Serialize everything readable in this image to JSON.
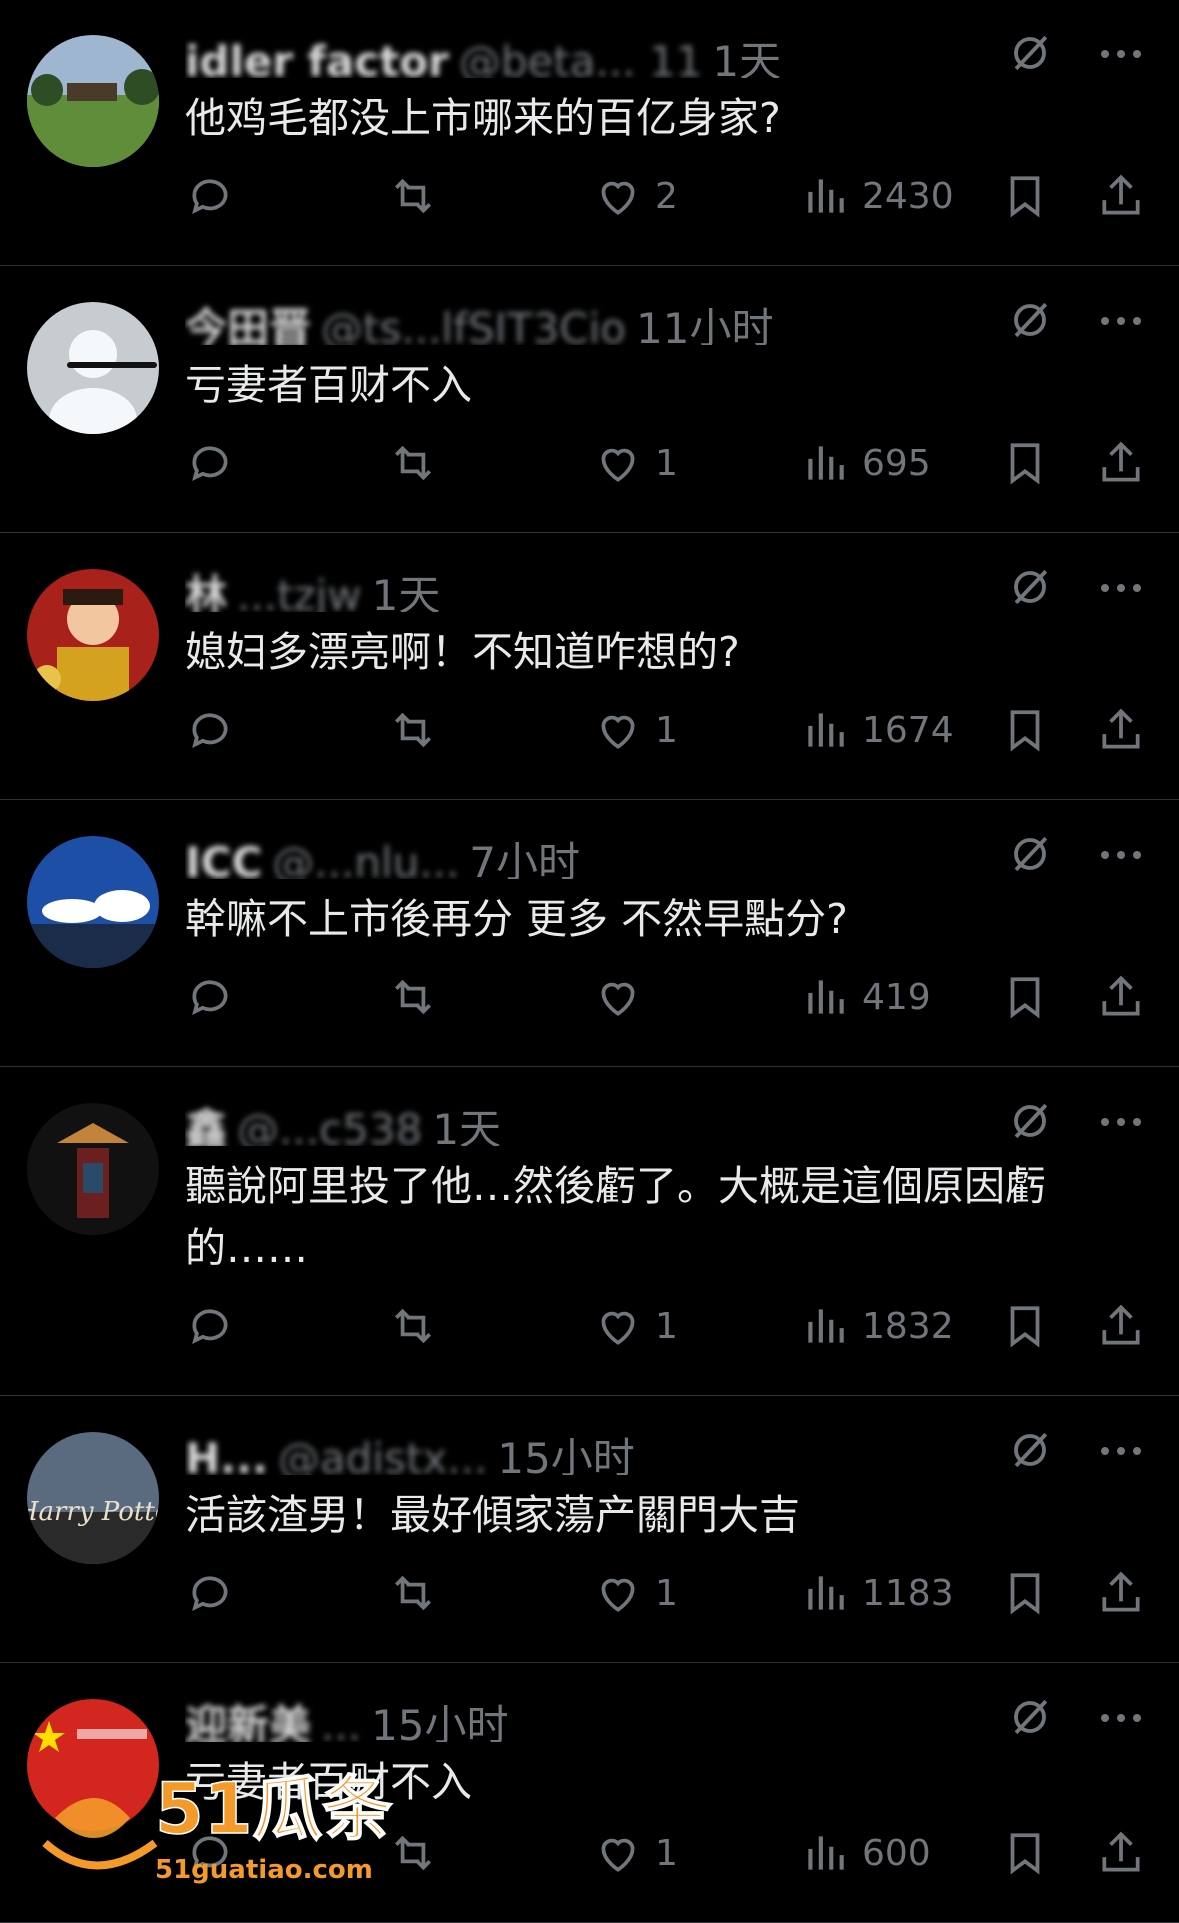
{
  "replies": [
    {
      "name": "idler factor",
      "handle": "@beta... 11",
      "time": "1天",
      "text": "他鸡毛都没上市哪来的百亿身家?",
      "likes": "2",
      "views": "2430",
      "avatar": "golf-course-avatar"
    },
    {
      "name": "今田晋",
      "handle": "@ts...lfSIT3Cio",
      "time": "11小时",
      "text": "亏妻者百财不入",
      "likes": "1",
      "views": "695",
      "avatar": "default-profile-avatar"
    },
    {
      "name": "林",
      "handle": "...tzjw",
      "time": "1天",
      "text": "媳妇多漂亮啊！不知道咋想的?",
      "likes": "1",
      "views": "1674",
      "avatar": "god-of-wealth-avatar"
    },
    {
      "name": "ICC",
      "handle": "@...nlu...",
      "time": "7小时",
      "text": "幹嘛不上市後再分 更多 不然早點分?",
      "likes": "",
      "views": "419",
      "avatar": "sky-clouds-avatar"
    },
    {
      "name": "鑫",
      "handle": "@...c538",
      "time": "1天",
      "text": "聽說阿里投了他…然後虧了。大概是這個原因虧的……",
      "likes": "1",
      "views": "1832",
      "avatar": "dark-figure-avatar"
    },
    {
      "name": "H...",
      "handle": "@adistx...",
      "time": "15小时",
      "text": "活該渣男！最好傾家蕩产關門大吉",
      "likes": "1",
      "views": "1183",
      "avatar": "harry-potter-avatar"
    },
    {
      "name": "迎新美",
      "handle": "...",
      "time": "15小时",
      "text": "亏妻者百财不入",
      "likes": "1",
      "views": "600",
      "avatar": "red-flag-avatar"
    }
  ],
  "watermark": {
    "brand": "51瓜条",
    "url": "51guatiao.com"
  },
  "colors": {
    "background": "#000000",
    "text": "#e7e9ea",
    "muted": "#71767b",
    "divider": "#2f3336"
  }
}
